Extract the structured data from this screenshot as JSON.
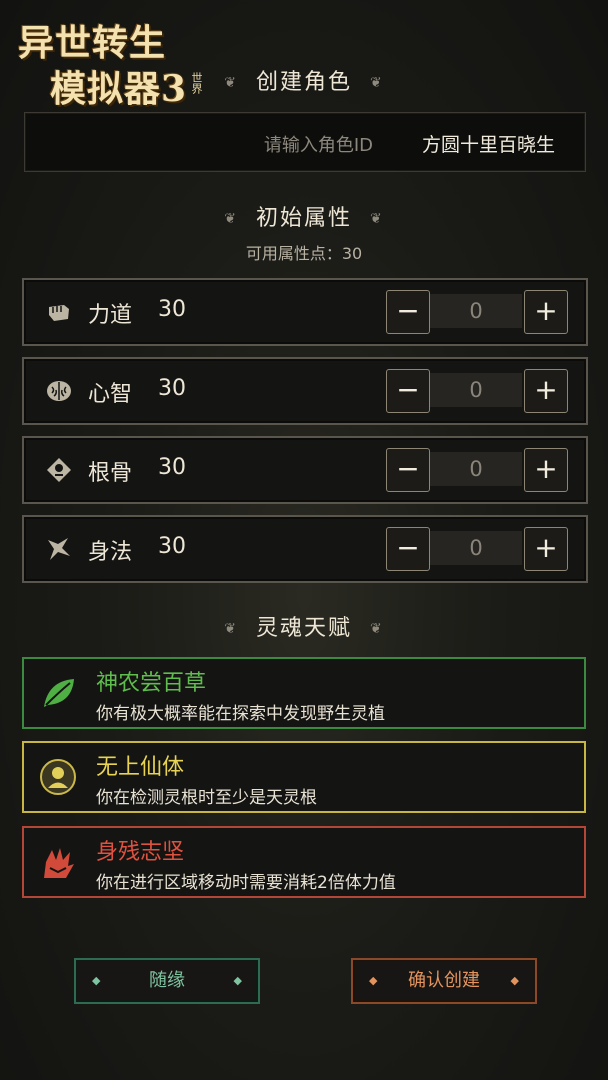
{
  "logo": {
    "line1": "异世转生",
    "line2": "模拟器3",
    "line3": "世界"
  },
  "create_section": {
    "title": "创建角色"
  },
  "id_input": {
    "placeholder": "请输入角色ID",
    "value": "方圆十里百晓生"
  },
  "attributes_section": {
    "title": "初始属性",
    "points_label": "可用属性点：30",
    "items": [
      {
        "icon": "fist-icon",
        "name": "力道",
        "value": "30",
        "added": "0"
      },
      {
        "icon": "brain-icon",
        "name": "心智",
        "value": "30",
        "added": "0"
      },
      {
        "icon": "bone-icon",
        "name": "根骨",
        "value": "30",
        "added": "0"
      },
      {
        "icon": "agility-icon",
        "name": "身法",
        "value": "30",
        "added": "0"
      }
    ],
    "minus_label": "−",
    "plus_label": "+"
  },
  "talents_section": {
    "title": "灵魂天赋",
    "items": [
      {
        "icon": "leaf-icon",
        "color": "#5fbd4d",
        "name": "神农尝百草",
        "desc": "你有极大概率能在探索中发现野生灵植"
      },
      {
        "icon": "immortal-body-icon",
        "color": "#e8d353",
        "name": "无上仙体",
        "desc": "你在检测灵根时至少是天灵根"
      },
      {
        "icon": "crippled-hand-icon",
        "color": "#df5240",
        "name": "身残志坚",
        "desc": "你在进行区域移动时需要消耗2倍体力值"
      }
    ]
  },
  "buttons": {
    "random": "随缘",
    "confirm": "确认创建"
  }
}
